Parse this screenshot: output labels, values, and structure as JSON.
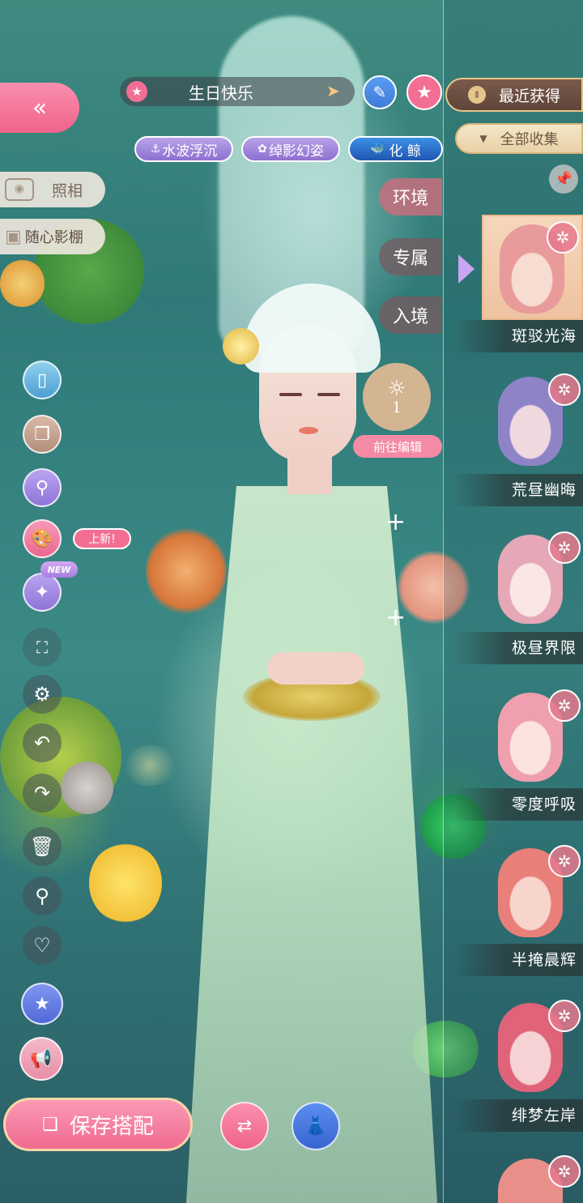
{
  "header": {
    "outfit_name": "生日快乐"
  },
  "tags": [
    {
      "label": "水波浮沉"
    },
    {
      "label": "绰影幻姿"
    },
    {
      "label": "化 鲸"
    }
  ],
  "left_menu": {
    "photo_label": "照相",
    "studio_label": "随心影棚",
    "new_badge": "上新!",
    "new_tag": "NEW",
    "save_label": "保存搭配"
  },
  "categories": [
    {
      "label": "环境"
    },
    {
      "label": "专属"
    },
    {
      "label": "入境"
    }
  ],
  "light": {
    "value": "1",
    "edit_label": "前往编辑"
  },
  "right_panel": {
    "sort_label": "最近获得",
    "filter_label": "全部收集",
    "items": [
      {
        "name": "斑驳光海",
        "selected": true,
        "hair": "#e99a9a"
      },
      {
        "name": "荒昼幽晦",
        "selected": false,
        "hair": "#8f83c8"
      },
      {
        "name": "极昼界限",
        "selected": false,
        "hair": "#e6a7b6"
      },
      {
        "name": "零度呼吸",
        "selected": false,
        "hair": "#ef9fad"
      },
      {
        "name": "半掩晨辉",
        "selected": false,
        "hair": "#e87f78"
      },
      {
        "name": "绯梦左岸",
        "selected": false,
        "hair": "#e0637a"
      }
    ]
  },
  "colors": {
    "pink": "#f26f93",
    "panel_gold": "#e6c58a",
    "tag_purple": "#8e6fd0"
  }
}
